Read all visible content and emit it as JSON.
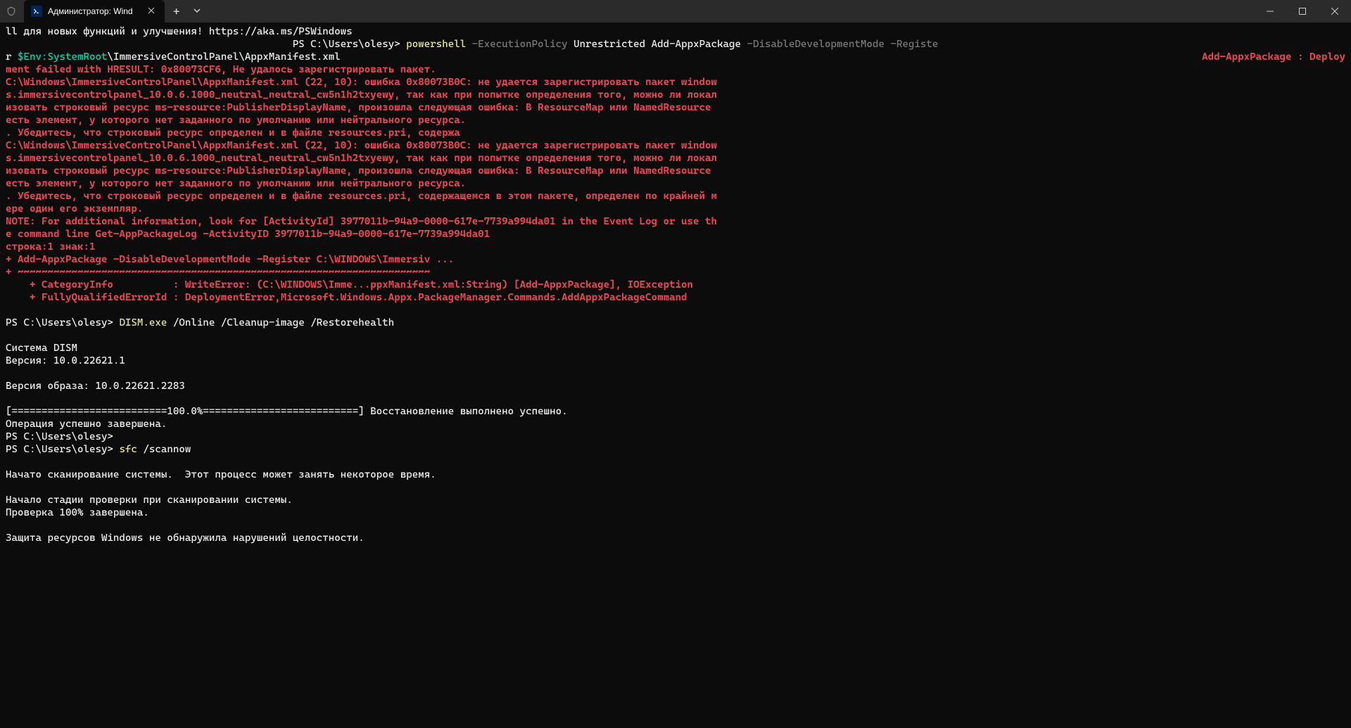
{
  "titlebar": {
    "tab_title": "Администратор: Wind",
    "new_tab": "+",
    "dropdown": "⌄",
    "minimize": "─",
    "maximize": "☐",
    "close": "✕"
  },
  "term": {
    "line1": "ll для новых функций и улучшения! https://aka.ms/PSWindows",
    "line2_indent": "                                                ",
    "line2_prompt": "PS C:\\Users\\olesy> ",
    "line2_cmd1": "powershell",
    "line2_gray1": " -ExecutionPolicy ",
    "line2_white1": "Unrestricted Add-AppxPackage",
    "line2_gray2": " -DisableDevelopmentMode -Registe",
    "line3_white": "r ",
    "line3_env": "$Env:SystemRoot",
    "line3_path": "\\ImmersiveControlPanel\\AppxManifest.xml",
    "err_head_a": "Add-AppxPackage : Deploy",
    "err_head_b": "ment failed with HRESULT: 0x80073CF6, Не удалось зарегистрировать пакет.",
    "err_block1": "C:\\Windows\\ImmersiveControlPanel\\AppxManifest.xml (22, 10): ошибка 0x80073B0C: не удается зарегистрировать пакет window\ns.immersivecontrolpanel_10.0.6.1000_neutral_neutral_cw5n1h2txyewy, так как при попытке определения того, можно ли локал\nизовать строковый ресурс ms-resource:PublisherDisplayName, произошла следующая ошибка: В ResourceMap или NamedResource\nесть элемент, у которого нет заданного по умолчанию или нейтрального ресурса.\n. Убедитесь, что строковый ресурс определен и в файле resources.pri, содержа\nC:\\Windows\\ImmersiveControlPanel\\AppxManifest.xml (22, 10): ошибка 0x80073B0C: не удается зарегистрировать пакет window\ns.immersivecontrolpanel_10.0.6.1000_neutral_neutral_cw5n1h2txyewy, так как при попытке определения того, можно ли локал\nизовать строковый ресурс ms-resource:PublisherDisplayName, произошла следующая ошибка: В ResourceMap или NamedResource\nесть элемент, у которого нет заданного по умолчанию или нейтрального ресурса.\n. Убедитесь, что строковый ресурс определен и в файле resources.pri, содержащемся в этом пакете, определен по крайней м\nере один его экземпляр.\nNOTE: For additional information, look for [ActivityId] 3977011b-94a9-0000-617e-7739a994da01 in the Event Log or use th\ne command line Get-AppPackageLog -ActivityID 3977011b-94a9-0000-617e-7739a994da01\nстрока:1 знак:1\n+ Add-AppxPackage -DisableDevelopmentMode -Register C:\\WINDOWS\\Immersiv ...\n+ ~~~~~~~~~~~~~~~~~~~~~~~~~~~~~~~~~~~~~~~~~~~~~~~~~~~~~~~~~~~~~~~~~~~~~\n    + CategoryInfo          : WriteError: (C:\\WINDOWS\\Imme...ppxManifest.xml:String) [Add-AppxPackage], IOException\n    + FullyQualifiedErrorId : DeploymentError,Microsoft.Windows.Appx.PackageManager.Commands.AddAppxPackageCommand",
    "blank": " ",
    "dism_prompt": "PS C:\\Users\\olesy> ",
    "dism_cmd": "DISM.exe",
    "dism_args": " /Online /Cleanup-image /Restorehealth",
    "dism_out": "Cистема DISM\nВерсия: 10.0.22621.1\n\nВерсия образа: 10.0.22621.2283\n\n[==========================100.0%==========================] Восстановление выполнено успешно.\nОперация успешно завершена.",
    "prompt2": "PS C:\\Users\\olesy>",
    "sfc_prompt": "PS C:\\Users\\olesy> ",
    "sfc_cmd": "sfc",
    "sfc_args": " /scannow",
    "sfc_out": "Начато сканирование системы.  Этот процесс может занять некоторое время.\n\nНачало стадии проверки при сканировании системы.\nПроверка 100% завершена.\n\nЗащита ресурсов Windows не обнаружила нарушений целостности."
  }
}
